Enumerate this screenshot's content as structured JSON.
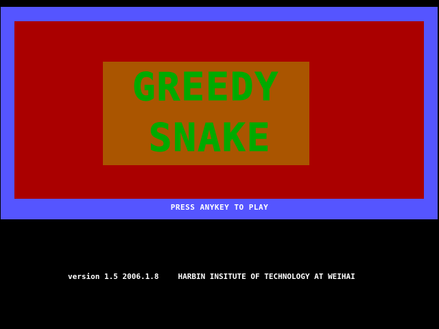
{
  "game": {
    "title_line1": "GREEDY",
    "title_line2": "SNAKE",
    "prompt": "PRESS ANYKEY TO PLAY",
    "version": "version 1.5 2006.1.8",
    "organization": "HARBIN INSITUTE OF TECHNOLOGY AT WEIHAI"
  },
  "colors": {
    "frame": "#5555ff",
    "panel": "#aa0000",
    "title_box": "#aa5500",
    "title_text": "#00aa00",
    "title_highlight": "#55ff55",
    "background": "#000000",
    "text": "#ffffff"
  }
}
